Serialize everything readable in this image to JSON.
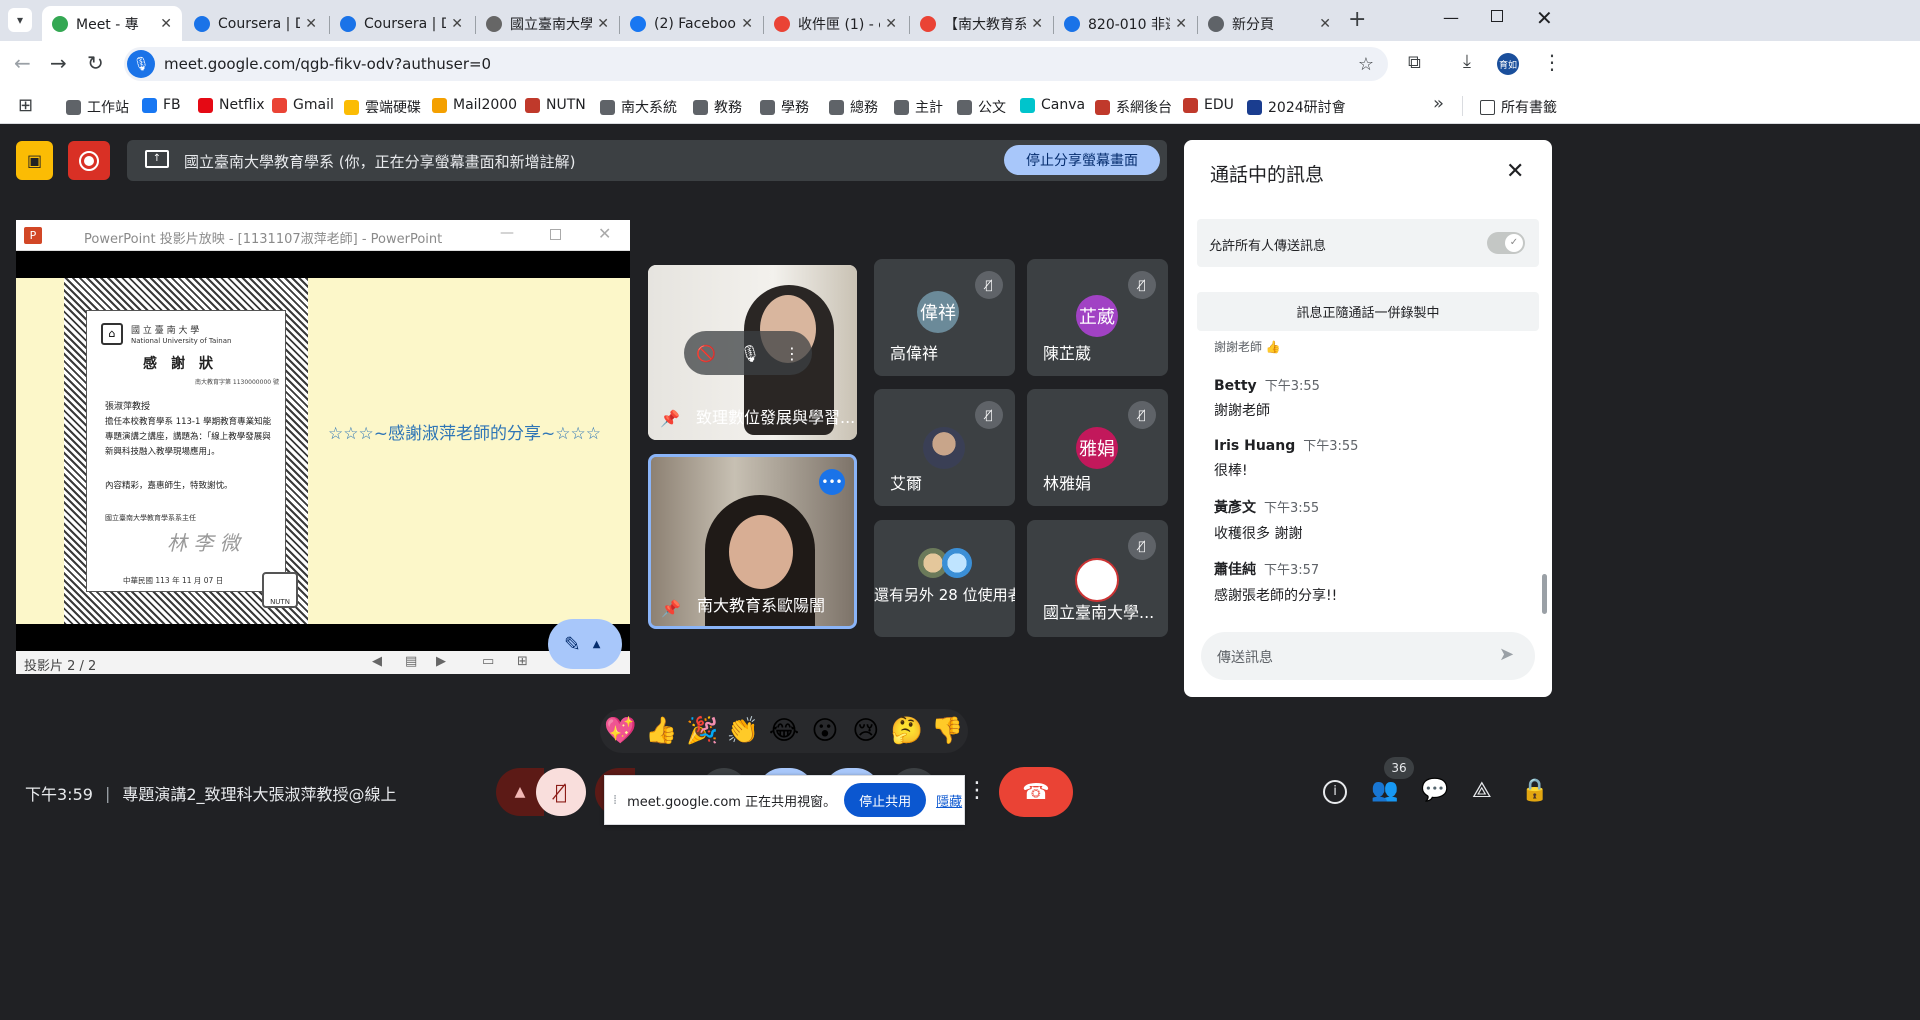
{
  "browser": {
    "tabs": [
      {
        "title": "Meet - 專",
        "color": "#34a853",
        "active": true
      },
      {
        "title": "Coursera | D",
        "color": "#1a73e8"
      },
      {
        "title": "Coursera | D",
        "color": "#1a73e8"
      },
      {
        "title": "國立臺南大學",
        "color": "#666666"
      },
      {
        "title": "(2) Facebook",
        "color": "#1877f2"
      },
      {
        "title": "收件匣 (1) - e",
        "color": "#ea4335"
      },
      {
        "title": "【南大教育系",
        "color": "#ea4335"
      },
      {
        "title": "820-010 非選",
        "color": "#1a73e8"
      },
      {
        "title": "新分頁",
        "color": "#5f6368"
      }
    ],
    "new_tab": "+",
    "url": "meet.google.com/qgb-fikv-odv?authuser=0",
    "profile": "育如",
    "bookmarks": [
      "工作站",
      "FB",
      "Netflix",
      "Gmail",
      "雲端硬碟",
      "Mail2000",
      "NUTN",
      "南大系統",
      "教務",
      "學務",
      "總務",
      "主計",
      "公文",
      "Canva",
      "系網後台",
      "EDU",
      "2024研討會"
    ],
    "bookmarks_overflow": "»",
    "all_bookmarks": "所有書籤"
  },
  "meet": {
    "share_banner": "國立臺南大學教育學系 (你，正在分享螢幕畫面和新增註解)",
    "stop_share": "停止分享螢幕畫面",
    "ppt": {
      "title": "PowerPoint 投影片放映 - [1131107淑萍老師] - PowerPoint",
      "status": "投影片 2 / 2",
      "thanks_text": "☆☆☆~感謝淑萍老師的分享~☆☆☆",
      "cert": {
        "univ_zh": "國 立 臺 南 大 學",
        "univ_en": "National University of Tainan",
        "heading": "感　謝　狀",
        "ref": "南大教育字第 1130000000 號",
        "name": "張淑萍教授",
        "body": "擔任本校教育學系 113-1 學期教育專業知能專題演講之講座，講題為：「線上教學發展與新興科技融入教學現場應用」。",
        "closing": "內容精彩，嘉惠師生，特致謝忱。",
        "issuer": "國立臺南大學教育學系系主任",
        "signature": "林 李 微",
        "date": "中華民國 113 年 11 月 07 日",
        "stamp": "NUTN"
      }
    },
    "tiles": [
      {
        "name": "致理數位發展與學習..."
      },
      {
        "name": "南大教育系歐陽闇"
      },
      {
        "name": "高偉祥",
        "avatar": "偉祥",
        "color": "#6b8a99"
      },
      {
        "name": "陳芷葳",
        "avatar": "芷葳",
        "color": "#a142c4"
      },
      {
        "name": "艾爾"
      },
      {
        "name": "林雅娟",
        "avatar": "雅娟",
        "color": "#c2185b"
      },
      {
        "name": "還有另外 28 位使用者"
      },
      {
        "name": "國立臺南大學..."
      }
    ],
    "chat": {
      "title": "通話中的訊息",
      "allow_label": "允許所有人傳送訊息",
      "recording_notice": "訊息正隨通話一併錄製中",
      "partial": "謝謝老師 👍",
      "messages": [
        {
          "name": "Betty",
          "time": "下午3:55",
          "text": "謝謝老師"
        },
        {
          "name": "Iris Huang",
          "time": "下午3:55",
          "text": "很棒!"
        },
        {
          "name": "黃彥文",
          "time": "下午3:55",
          "text": "收穫很多 謝謝"
        },
        {
          "name": "蕭佳純",
          "time": "下午3:57",
          "text": "感謝張老師的分享!!"
        }
      ],
      "input_placeholder": "傳送訊息"
    },
    "emojis": [
      "💖",
      "👍",
      "🎉",
      "👏",
      "😂",
      "😮",
      "😢",
      "🤔",
      "👎"
    ],
    "clock": "下午3:59",
    "meeting_title": "專題演講2_致理科大張淑萍教授@線上",
    "people_count": "36",
    "share_notice": {
      "text": "meet.google.com 正在共用視窗。",
      "stop": "停止共用",
      "hide": "隱藏"
    }
  }
}
